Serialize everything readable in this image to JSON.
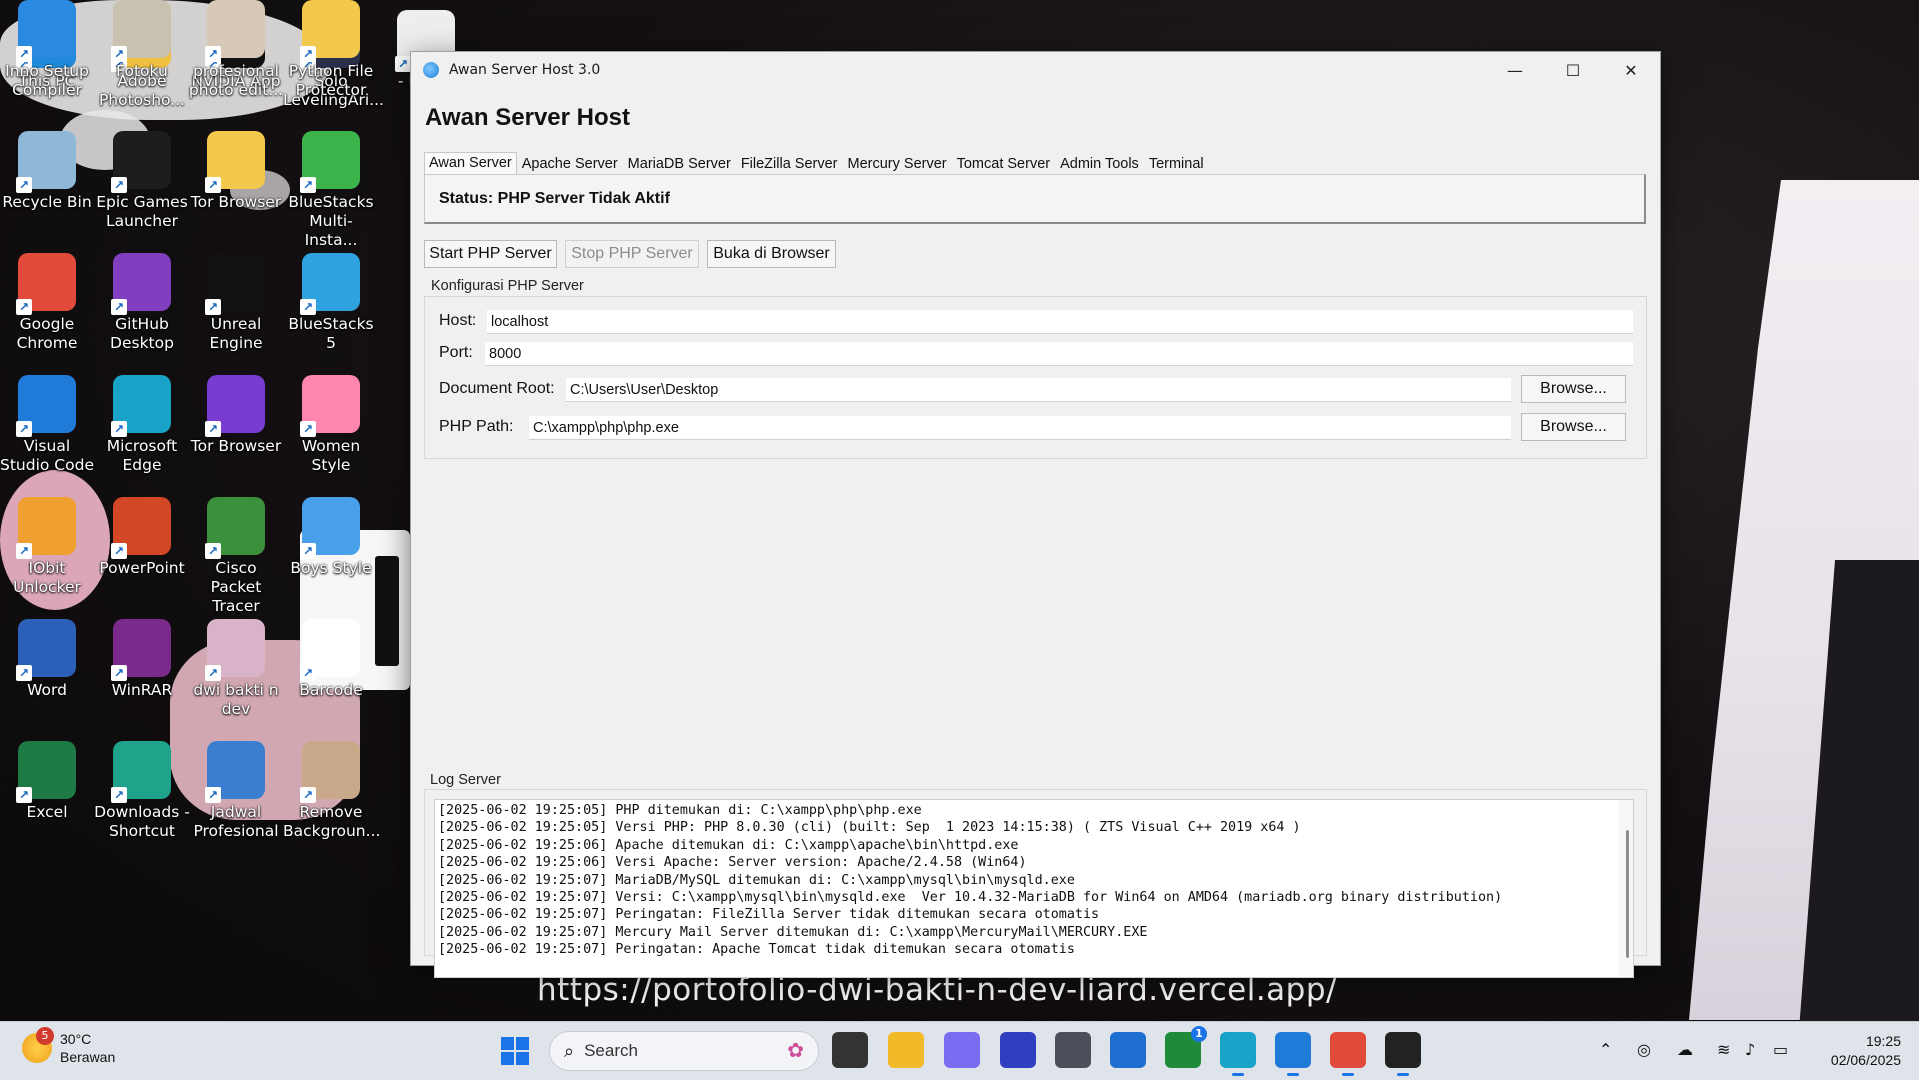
{
  "wallpaper": {
    "url_text": "https://portofolio-dwi-bakti-n-dev-liard.vercel.app/"
  },
  "desktop_icons": [
    {
      "label": "This PC",
      "icon": "monitor-icon",
      "color": "#1f8ad8"
    },
    {
      "label": "Adobe Photosho...",
      "icon": "folder-icon",
      "color": "#f0c040"
    },
    {
      "label": "NVIDIA App",
      "icon": "nvidia-icon",
      "color": "#111111"
    },
    {
      "label": "Solo LevelingAri...",
      "icon": "game-icon",
      "color": "#2b2f4a"
    },
    {
      "label": "- B App",
      "icon": "file-icon",
      "color": "#eeeeee"
    },
    {
      "label": "Recycle Bin",
      "icon": "recycle-bin-icon",
      "color": "#8fb8d8"
    },
    {
      "label": "Epic Games Launcher",
      "icon": "epic-games-icon",
      "color": "#1d1d1d"
    },
    {
      "label": "Tor Browser",
      "icon": "folder-icon",
      "color": "#f2c94c"
    },
    {
      "label": "BlueStacks Multi-Insta...",
      "icon": "bluestacks-icon",
      "color": "#3cb44b"
    },
    {
      "label": "Google Chrome",
      "icon": "chrome-icon",
      "color": "#e24a3b"
    },
    {
      "label": "GitHub Desktop",
      "icon": "github-icon",
      "color": "#7f3fbf"
    },
    {
      "label": "Unreal Engine",
      "icon": "unreal-icon",
      "color": "#111111"
    },
    {
      "label": "BlueStacks 5",
      "icon": "bluestacks-icon",
      "color": "#2fa3e0"
    },
    {
      "label": "Visual Studio Code",
      "icon": "vscode-icon",
      "color": "#1f7ad8"
    },
    {
      "label": "Microsoft Edge",
      "icon": "edge-icon",
      "color": "#1aa3c8"
    },
    {
      "label": "Tor Browser",
      "icon": "tor-icon",
      "color": "#7a3bd1"
    },
    {
      "label": "Women Style",
      "icon": "app-icon",
      "color": "#ff86b0"
    },
    {
      "label": "IObit Unlocker",
      "icon": "lock-icon",
      "color": "#f0a030"
    },
    {
      "label": "PowerPoint",
      "icon": "powerpoint-icon",
      "color": "#d24726"
    },
    {
      "label": "Cisco Packet Tracer",
      "icon": "cisco-icon",
      "color": "#3c8f3c"
    },
    {
      "label": "Boys Style",
      "icon": "app-icon",
      "color": "#4aa0e8"
    },
    {
      "label": "Word",
      "icon": "word-icon",
      "color": "#2b5fb8"
    },
    {
      "label": "WinRAR",
      "icon": "winrar-icon",
      "color": "#7a2a8a"
    },
    {
      "label": "dwi bakti n dev",
      "icon": "image-icon",
      "color": "#d9b4c8"
    },
    {
      "label": "Barcode",
      "icon": "qr-code-icon",
      "color": "#ffffff"
    },
    {
      "label": "Excel",
      "icon": "excel-icon",
      "color": "#1e7a45"
    },
    {
      "label": "Downloads - Shortcut",
      "icon": "download-icon",
      "color": "#1fa38a"
    },
    {
      "label": "Jadwal Profesional",
      "icon": "calendar-icon",
      "color": "#3b7fd0"
    },
    {
      "label": "Remove Backgroun...",
      "icon": "image-icon",
      "color": "#c9a98a"
    },
    {
      "label": "Inno Setup Compiler",
      "icon": "installer-icon",
      "color": "#2a8ae0"
    },
    {
      "label": "Fotoku",
      "icon": "image-icon",
      "color": "#c9c2b0"
    },
    {
      "label": "profesional photo edit...",
      "icon": "image-icon",
      "color": "#d8c8b8"
    },
    {
      "label": "Python File Protector",
      "icon": "folder-icon",
      "color": "#f2c94c"
    }
  ],
  "window": {
    "title": "Awan Server Host 3.0",
    "minimize_glyph": "—",
    "maximize_glyph": "☐",
    "close_glyph": "✕",
    "heading": "Awan Server Host",
    "tabs": [
      {
        "label": "Awan Server",
        "active": true
      },
      {
        "label": "Apache Server",
        "active": false
      },
      {
        "label": "MariaDB Server",
        "active": false
      },
      {
        "label": "FileZilla Server",
        "active": false
      },
      {
        "label": "Mercury Server",
        "active": false
      },
      {
        "label": "Tomcat Server",
        "active": false
      },
      {
        "label": "Admin Tools",
        "active": false
      },
      {
        "label": "Terminal",
        "active": false
      }
    ],
    "status": "Status: PHP Server Tidak Aktif",
    "buttons": {
      "start": "Start PHP Server",
      "stop": "Stop PHP Server",
      "stop_disabled": true,
      "open_browser": "Buka di Browser"
    },
    "config": {
      "group_title": "Konfigurasi PHP Server",
      "host_label": "Host:",
      "host_value": "localhost",
      "port_label": "Port:",
      "port_value": "8000",
      "docroot_label": "Document Root:",
      "docroot_value": "C:\\Users\\User\\Desktop",
      "phppath_label": "PHP Path:",
      "phppath_value": "C:\\xampp\\php\\php.exe",
      "browse_label": "Browse..."
    },
    "log": {
      "group_title": "Log Server",
      "lines": [
        "[2025-06-02 19:25:05] PHP ditemukan di: C:\\xampp\\php\\php.exe",
        "[2025-06-02 19:25:05] Versi PHP: PHP 8.0.30 (cli) (built: Sep  1 2023 14:15:38) ( ZTS Visual C++ 2019 x64 )",
        "[2025-06-02 19:25:06] Apache ditemukan di: C:\\xampp\\apache\\bin\\httpd.exe",
        "[2025-06-02 19:25:06] Versi Apache: Server version: Apache/2.4.58 (Win64)",
        "[2025-06-02 19:25:07] MariaDB/MySQL ditemukan di: C:\\xampp\\mysql\\bin\\mysqld.exe",
        "[2025-06-02 19:25:07] Versi: C:\\xampp\\mysql\\bin\\mysqld.exe  Ver 10.4.32-MariaDB for Win64 on AMD64 (mariadb.org binary distribution)",
        "[2025-06-02 19:25:07] Peringatan: FileZilla Server tidak ditemukan secara otomatis",
        "[2025-06-02 19:25:07] Mercury Mail Server ditemukan di: C:\\xampp\\MercuryMail\\MERCURY.EXE",
        "[2025-06-02 19:25:07] Peringatan: Apache Tomcat tidak ditemukan secara otomatis"
      ]
    }
  },
  "taskbar": {
    "weather_temp": "30°C",
    "weather_desc": "Berawan",
    "weather_badge": "5",
    "search_placeholder": "Search",
    "apps": [
      {
        "name": "task-view",
        "icon": "task-view-icon",
        "color": "#333333"
      },
      {
        "name": "file-explorer",
        "icon": "folder-icon",
        "color": "#f2b928"
      },
      {
        "name": "copilot",
        "icon": "copilot-icon",
        "color": "#7a6cf0"
      },
      {
        "name": "designer",
        "icon": "pen-icon",
        "color": "#2f3fbf"
      },
      {
        "name": "cube-app",
        "icon": "cube-icon",
        "color": "#4a4f5a"
      },
      {
        "name": "microsoft-store",
        "icon": "store-icon",
        "color": "#1f6fd0"
      },
      {
        "name": "xbox",
        "icon": "xbox-icon",
        "color": "#1e8a3a",
        "badge": "1"
      },
      {
        "name": "edge",
        "icon": "edge-icon",
        "color": "#1aa3c8"
      },
      {
        "name": "vscode",
        "icon": "vscode-icon",
        "color": "#1f7ad8"
      },
      {
        "name": "chrome",
        "icon": "chrome-icon",
        "color": "#e24a3b"
      },
      {
        "name": "feather-app",
        "icon": "feather-icon",
        "color": "#222222"
      }
    ],
    "clock_time": "19:25",
    "clock_date": "02/06/2025"
  }
}
